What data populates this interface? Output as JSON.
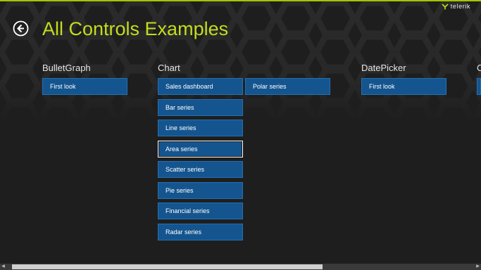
{
  "app": {
    "title": "All Controls Examples",
    "logo_text": "telerik",
    "accent_color": "#c3dd1c",
    "tile_color": "#14558f"
  },
  "groups": [
    {
      "header": "BulletGraph",
      "tiles": [
        "First look"
      ]
    },
    {
      "header": "Chart",
      "tiles": [
        "Sales dashboard",
        "Bar series",
        "Line series",
        "Area series",
        "Scatter series",
        "Pie series",
        "Financial series",
        "Radar series",
        "Polar series"
      ]
    },
    {
      "header": "DatePicker",
      "tiles": [
        "First look"
      ]
    },
    {
      "header": "C"
    }
  ],
  "icons": {
    "back": "back-arrow-icon",
    "logo": "telerik-logo-icon"
  }
}
